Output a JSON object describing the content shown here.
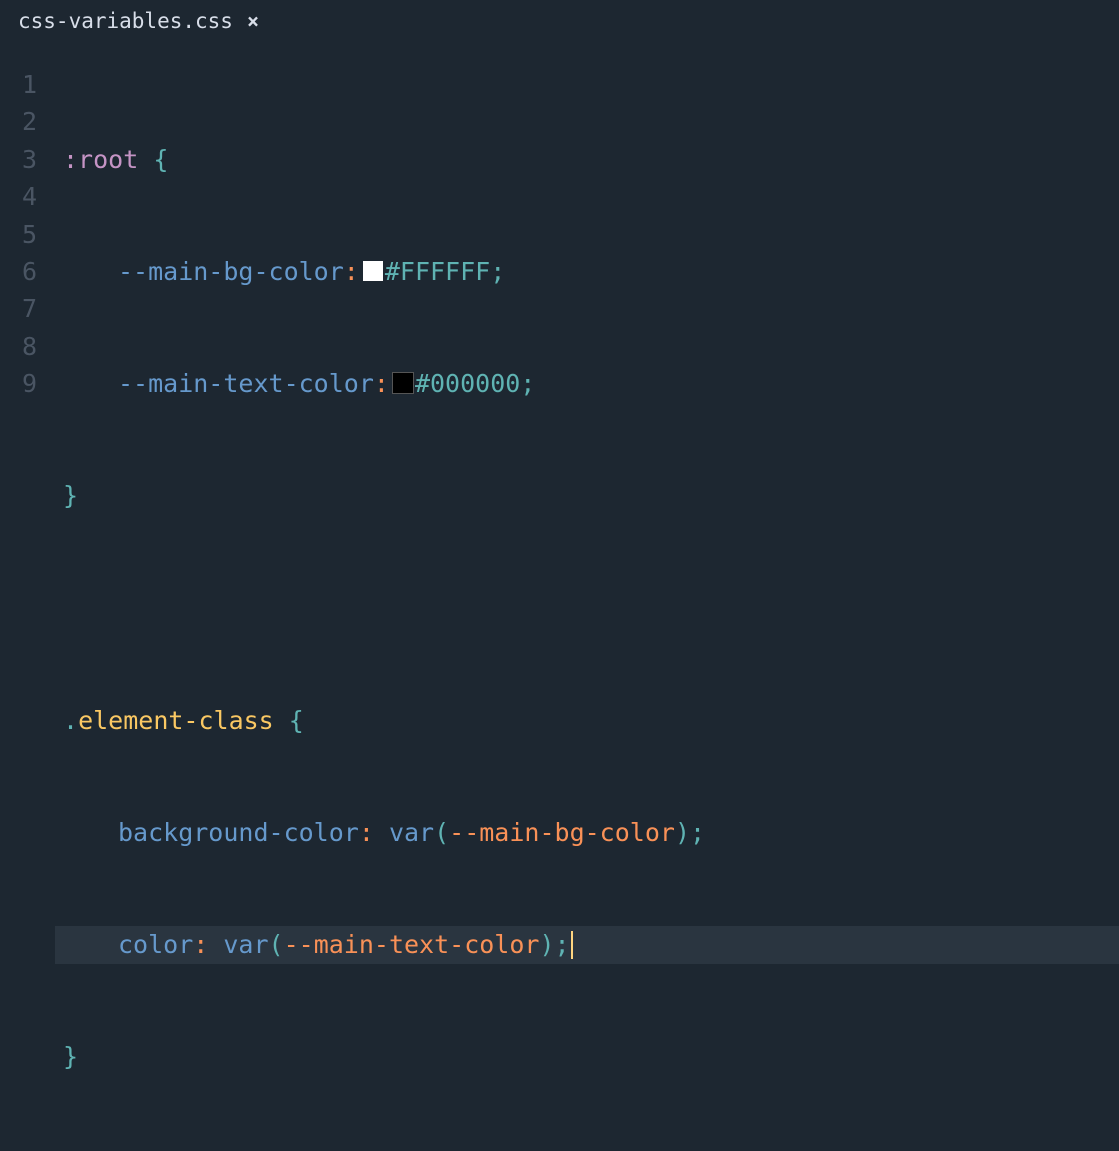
{
  "tab": {
    "filename": "css-variables.css"
  },
  "editor": {
    "line_numbers": [
      "1",
      "2",
      "3",
      "4",
      "5",
      "6",
      "7",
      "8",
      "9"
    ],
    "active_line": 8,
    "code": {
      "l1_selector": ":root",
      "l1_brace": " {",
      "l2_prop": "--main-bg-color",
      "l2_colon": ":",
      "l2_hex": "#FFFFFF",
      "l2_semi": ";",
      "l3_prop": "--main-text-color",
      "l3_colon": ":",
      "l3_hex": "#000000",
      "l3_semi": ";",
      "l4_brace": "}",
      "l6_dot": ".",
      "l6_class": "element-class",
      "l6_brace": " {",
      "l7_prop": "background-color",
      "l7_colon": ": ",
      "l7_func": "var",
      "l7_paren_open": "(",
      "l7_var": "--main-bg-color",
      "l7_paren_close": ")",
      "l7_semi": ";",
      "l8_prop": "color",
      "l8_colon": ": ",
      "l8_func": "var",
      "l8_paren_open": "(",
      "l8_var": "--main-text-color",
      "l8_paren_close": ")",
      "l8_semi": ";",
      "l9_brace": "}"
    }
  }
}
